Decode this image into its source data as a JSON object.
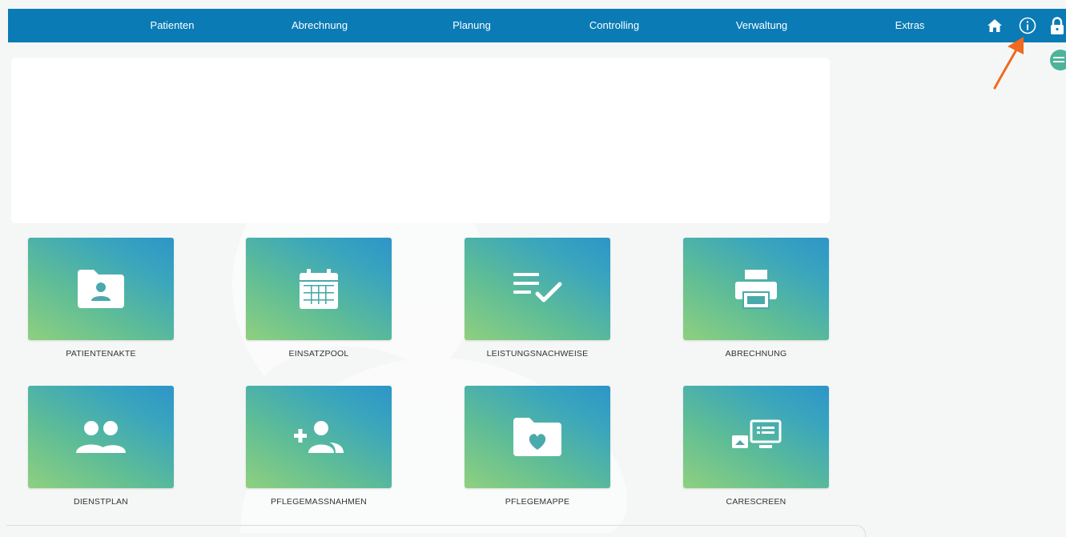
{
  "nav": {
    "items": [
      {
        "label": "Patienten"
      },
      {
        "label": "Abrechnung"
      },
      {
        "label": "Planung"
      },
      {
        "label": "Controlling"
      },
      {
        "label": "Verwaltung"
      },
      {
        "label": "Extras"
      }
    ],
    "icons": [
      "home-icon",
      "info-icon",
      "lock-icon"
    ]
  },
  "tiles": [
    {
      "label": "PATIENTENAKTE",
      "icon": "patient-folder-icon"
    },
    {
      "label": "EINSATZPOOL",
      "icon": "calendar-icon"
    },
    {
      "label": "LEISTUNGSNACHWEISE",
      "icon": "checklist-icon"
    },
    {
      "label": "ABRECHNUNG",
      "icon": "printer-icon"
    },
    {
      "label": "DIENSTPLAN",
      "icon": "people-icon"
    },
    {
      "label": "PFLEGEMASSNAHMEN",
      "icon": "add-person-icon"
    },
    {
      "label": "PFLEGEMAPPE",
      "icon": "heart-folder-icon"
    },
    {
      "label": "CARESCREEN",
      "icon": "monitor-icon"
    }
  ],
  "colors": {
    "topbar": "#0a7bb5",
    "tile_gradient_start": "#8fd07f",
    "tile_gradient_end": "#2e95c8",
    "side_button": "#4db39b",
    "annotation_arrow": "#f06a1f"
  }
}
